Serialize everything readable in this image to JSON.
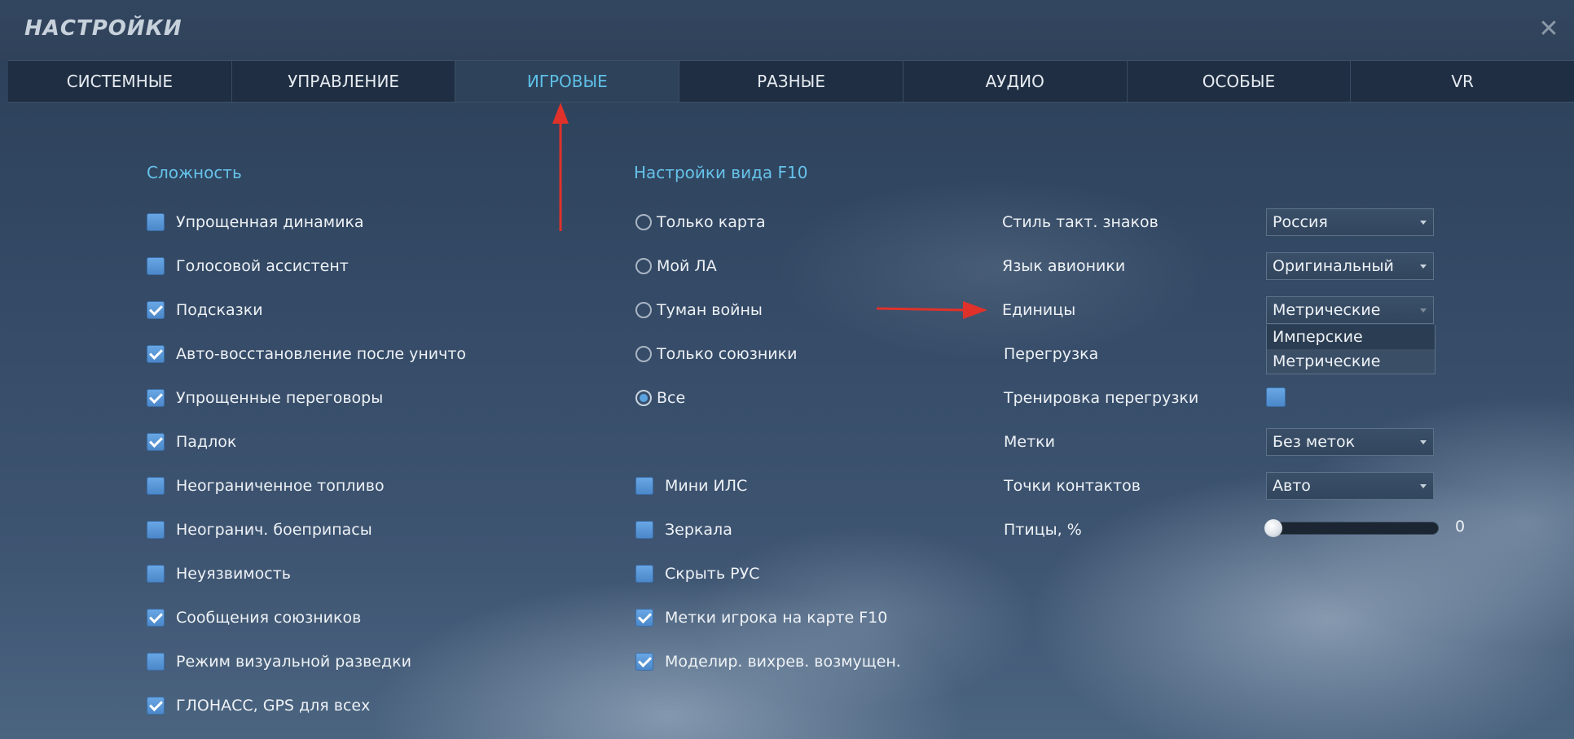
{
  "window": {
    "title": "НАСТРОЙКИ",
    "close_glyph": "✕"
  },
  "tabs": [
    {
      "label": "СИСТЕМНЫЕ",
      "active": false
    },
    {
      "label": "УПРАВЛЕНИЕ",
      "active": false
    },
    {
      "label": "ИГРОВЫЕ",
      "active": true
    },
    {
      "label": "РАЗНЫЕ",
      "active": false
    },
    {
      "label": "АУДИО",
      "active": false
    },
    {
      "label": "ОСОБЫЕ",
      "active": false
    },
    {
      "label": "VR",
      "active": false
    }
  ],
  "difficulty": {
    "title": "Сложность",
    "items": [
      {
        "label": "Упрощенная динамика",
        "checked": false
      },
      {
        "label": "Голосовой ассистент",
        "checked": false
      },
      {
        "label": "Подсказки",
        "checked": true
      },
      {
        "label": "Авто-восстановление после уничтожения",
        "checked": true
      },
      {
        "label": "Упрощенные переговоры",
        "checked": true
      },
      {
        "label": "Падлок",
        "checked": true
      },
      {
        "label": "Неограниченное топливо",
        "checked": false
      },
      {
        "label": "Неогранич. боеприпасы",
        "checked": false
      },
      {
        "label": "Неуязвимость",
        "checked": false
      },
      {
        "label": "Сообщения союзников",
        "checked": true
      },
      {
        "label": "Режим визуальной разведки",
        "checked": false
      },
      {
        "label": "ГЛОНАСС, GPS для всех",
        "checked": true
      }
    ]
  },
  "f10_view": {
    "title": "Настройки вида F10",
    "radios": [
      {
        "label": "Только карта",
        "checked": false
      },
      {
        "label": "Мой ЛА",
        "checked": false
      },
      {
        "label": "Туман войны",
        "checked": false
      },
      {
        "label": "Только союзники",
        "checked": false
      },
      {
        "label": "Все",
        "checked": true
      }
    ],
    "checkboxes": [
      {
        "label": "Мини ИЛС",
        "checked": false
      },
      {
        "label": "Зеркала",
        "checked": false
      },
      {
        "label": "Скрыть РУС",
        "checked": false
      },
      {
        "label": "Метки игрока на карте F10",
        "checked": true
      },
      {
        "label": "Моделир. вихрев. возмущен.",
        "checked": true
      }
    ]
  },
  "options": {
    "tactical_symbols": {
      "label": "Стиль такт. знаков",
      "value": "Россия"
    },
    "avionics_language": {
      "label": "Язык авионики",
      "value": "Оригинальный"
    },
    "units": {
      "label": "Единицы",
      "value": "Метрические",
      "open": true,
      "options": [
        "Имперские",
        "Метрические"
      ]
    },
    "g_load": {
      "label": "Перегрузка"
    },
    "g_training": {
      "label": "Тренировка перегрузки",
      "checked": false
    },
    "labels": {
      "label": "Метки",
      "value": "Без меток"
    },
    "contact_points": {
      "label": "Точки контактов",
      "value": "Авто"
    },
    "birds": {
      "label": "Птицы, %",
      "value": "0",
      "fraction": 0
    }
  },
  "annotation_color": "#e0322a"
}
